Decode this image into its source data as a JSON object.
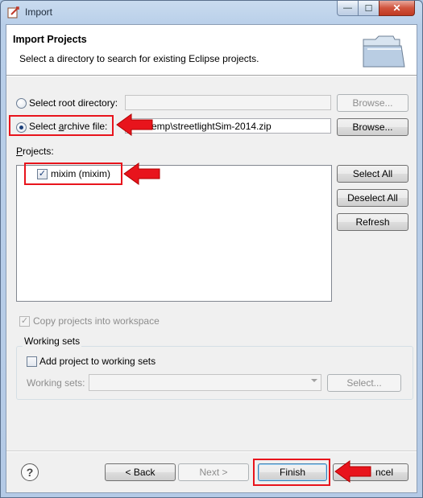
{
  "window": {
    "title": "Import",
    "minimize": "—",
    "maximize": "☐",
    "close": "✕"
  },
  "banner": {
    "title": "Import Projects",
    "description": "Select a directory to search for existing Eclipse projects."
  },
  "source": {
    "root_dir_label": "Select root directory:",
    "root_dir_value": "",
    "root_browse": "Browse...",
    "archive_label": "Select archive file:",
    "archive_value": "emp\\streetlightSim-2014.zip",
    "archive_browse": "Browse...",
    "selected": "archive"
  },
  "projects": {
    "label": "Projects:",
    "items": [
      {
        "label": "mixim (mixim)",
        "checked": true
      }
    ],
    "select_all": "Select All",
    "deselect_all": "Deselect All",
    "refresh": "Refresh"
  },
  "options": {
    "copy_label": "Copy projects into workspace",
    "copy_checked": true
  },
  "working_sets": {
    "group_title": "Working sets",
    "add_label": "Add project to working sets",
    "add_checked": false,
    "sets_label": "Working sets:",
    "sets_value": "",
    "select_button": "Select..."
  },
  "footer": {
    "help": "?",
    "back": "< Back",
    "next": "Next >",
    "finish": "Finish",
    "cancel": "ncel"
  },
  "annotation_color": "#e8141c"
}
